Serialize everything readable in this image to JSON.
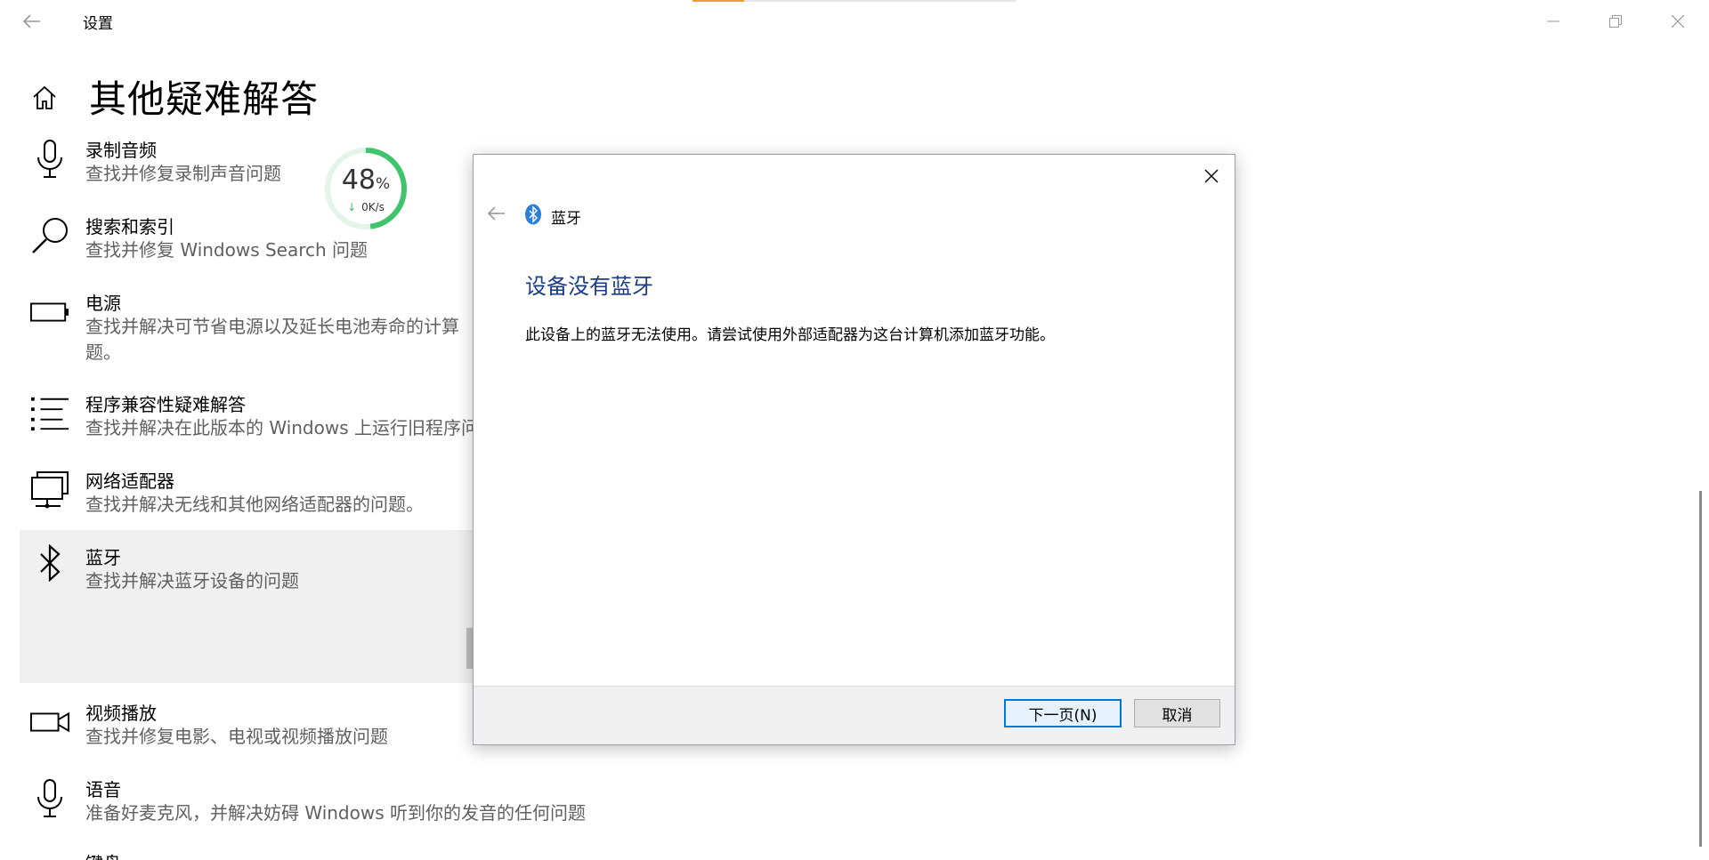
{
  "window": {
    "title": "设置",
    "progress_strip_fraction": 0.16,
    "controls": [
      "minimize-icon",
      "restore-icon",
      "close-icon"
    ]
  },
  "page": {
    "title": "其他疑难解答"
  },
  "items": [
    {
      "title": "录制音频",
      "desc": "查找并修复录制声音问题",
      "icon": "microphone-icon"
    },
    {
      "title": "搜索和索引",
      "desc": "查找并修复 Windows Search 问题",
      "icon": "search-icon"
    },
    {
      "title": "电源",
      "desc": "查找并解决可节省电源以及延长电池寿命的计算",
      "desc2": "题。",
      "icon": "battery-icon"
    },
    {
      "title": "程序兼容性疑难解答",
      "desc": "查找并解决在此版本的 Windows 上运行旧程序问",
      "icon": "list-icon"
    },
    {
      "title": "网络适配器",
      "desc": "查找并解决无线和其他网络适配器的问题。",
      "icon": "network-icon"
    },
    {
      "title": "蓝牙",
      "desc": "查找并解决蓝牙设备的问题",
      "icon": "bluetooth-icon"
    },
    {
      "title": "视频播放",
      "desc": "查找并修复电影、电视或视频播放问题",
      "icon": "video-camera-icon"
    },
    {
      "title": "语音",
      "desc": "准备好麦克风，并解决妨碍 Windows 听到你的发音的任何问题",
      "icon": "microphone-icon"
    },
    {
      "title": "键盘",
      "icon": "keyboard-icon"
    }
  ],
  "gauge": {
    "percent": "48",
    "percent_unit": "%",
    "speed": "0K/s",
    "value": 0.48,
    "color": "#3fc36b"
  },
  "dialog": {
    "header_label": "蓝牙",
    "heading": "设备没有蓝牙",
    "body": "此设备上的蓝牙无法使用。请尝试使用外部适配器为这台计算机添加蓝牙功能。",
    "next_button": "下一页(N)",
    "cancel_button": "取消",
    "heading_color": "#1b3b83",
    "accent": "#0078d7"
  }
}
